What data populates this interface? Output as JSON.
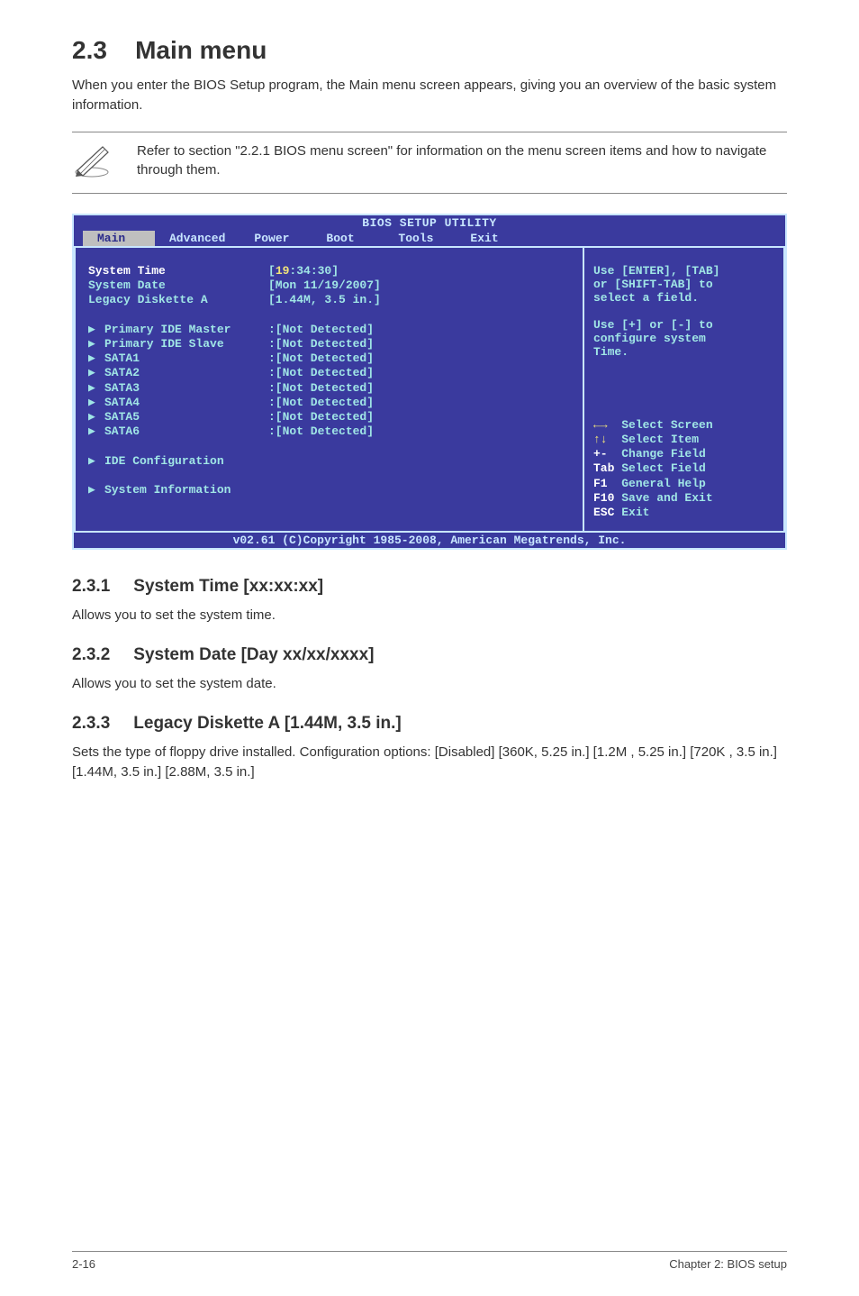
{
  "section": {
    "number": "2.3",
    "title": "Main menu",
    "intro": "When you enter the BIOS Setup program, the Main menu screen appears, giving you an overview of the basic system information."
  },
  "note": {
    "text": "Refer to section \"2.2.1  BIOS menu screen\" for information on the menu screen items and how to navigate through them."
  },
  "bios": {
    "header": "BIOS SETUP UTILITY",
    "tabs": [
      "Main",
      "Advanced",
      "Power",
      "Boot",
      "Tools",
      "Exit"
    ],
    "fields": [
      {
        "label": "System Time",
        "value": "[19:34:30]",
        "highlight": true,
        "yellow_segment": "19"
      },
      {
        "label": "System Date",
        "value": "[Mon 11/19/2007]"
      },
      {
        "label": "Legacy Diskette A",
        "value": "[1.44M, 3.5 in.]"
      }
    ],
    "devices": [
      {
        "label": "Primary IDE Master",
        "value": ":[Not Detected]"
      },
      {
        "label": "Primary IDE Slave",
        "value": ":[Not Detected]"
      },
      {
        "label": "SATA1",
        "value": ":[Not Detected]"
      },
      {
        "label": "SATA2",
        "value": ":[Not Detected]"
      },
      {
        "label": "SATA3",
        "value": ":[Not Detected]"
      },
      {
        "label": "SATA4",
        "value": ":[Not Detected]"
      },
      {
        "label": "SATA5",
        "value": ":[Not Detected]"
      },
      {
        "label": "SATA6",
        "value": ":[Not Detected]"
      }
    ],
    "extra_items": [
      "IDE Configuration",
      "System Information"
    ],
    "help": {
      "lines": [
        "Use [ENTER], [TAB]",
        "or [SHIFT-TAB] to",
        "select a field.",
        "",
        "Use [+] or [-] to",
        "configure system",
        "Time."
      ],
      "keys": [
        {
          "k": "←→",
          "d": "Select Screen",
          "arrow": true
        },
        {
          "k": "↑↓",
          "d": "Select Item",
          "arrow": true
        },
        {
          "k": "+-",
          "d": "Change Field"
        },
        {
          "k": "Tab",
          "d": "Select Field"
        },
        {
          "k": "F1",
          "d": "General Help"
        },
        {
          "k": "F10",
          "d": "Save and Exit"
        },
        {
          "k": "ESC",
          "d": "Exit"
        }
      ]
    },
    "footer": "v02.61 (C)Copyright 1985-2008, American Megatrends, Inc."
  },
  "subs": [
    {
      "num": "2.3.1",
      "title": "System Time [xx:xx:xx]",
      "body": "Allows you to set the system time."
    },
    {
      "num": "2.3.2",
      "title": "System Date [Day xx/xx/xxxx]",
      "body": "Allows you to set the system date."
    },
    {
      "num": "2.3.3",
      "title": "Legacy Diskette A [1.44M, 3.5 in.]",
      "body": "Sets the type of floppy drive installed. Configuration options: [Disabled] [360K, 5.25 in.] [1.2M , 5.25 in.] [720K , 3.5 in.] [1.44M, 3.5 in.] [2.88M, 3.5 in.]"
    }
  ],
  "footer": {
    "left": "2-16",
    "right": "Chapter 2: BIOS setup"
  }
}
